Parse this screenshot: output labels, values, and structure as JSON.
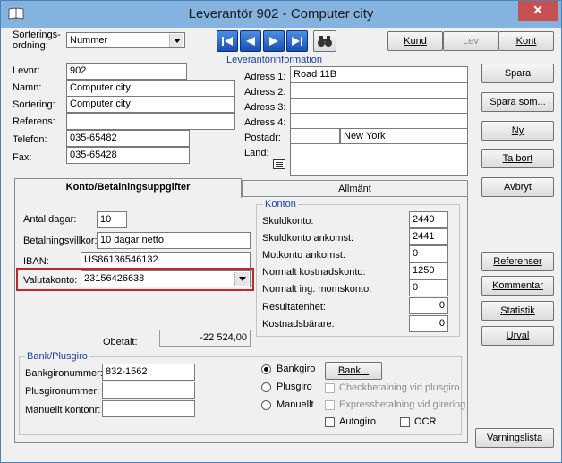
{
  "window": {
    "title": "Leverantör 902 - Computer city",
    "close_glyph": "✕"
  },
  "sort": {
    "label_line1": "Sorterings-",
    "label_line2": "ordning:",
    "value": "Nummer"
  },
  "toolbar": {
    "kund_label": "Kund",
    "lev_label": "Lev",
    "kont_label": "Kont"
  },
  "supplier": {
    "section_title": "Leverantörinformation",
    "levnr_label": "Levnr:",
    "levnr": "902",
    "namn_label": "Namn:",
    "namn": "Computer city",
    "sortering_label": "Sortering:",
    "sortering": "Computer city",
    "referens_label": "Referens:",
    "referens": "",
    "telefon_label": "Telefon:",
    "telefon": "035-65482",
    "fax_label": "Fax:",
    "fax": "035-65428",
    "adress1_label": "Adress 1:",
    "adress1": "Road 11B",
    "adress2_label": "Adress 2:",
    "adress2": "",
    "adress3_label": "Adress 3:",
    "adress3": "",
    "adress4_label": "Adress 4:",
    "adress4": "",
    "postadr_label": "Postadr:",
    "postnr": "",
    "ort": "New York",
    "land_label": "Land:",
    "land": "",
    "land2": ""
  },
  "side_buttons": {
    "spara": "Spara",
    "spara_som": "Spara som...",
    "ny": "Ny",
    "ta_bort": "Ta bort",
    "avbryt": "Avbryt",
    "referenser": "Referenser",
    "kommentar": "Kommentar",
    "statistik": "Statistik",
    "urval": "Urval",
    "varningslista": "Varningslista"
  },
  "tabs": {
    "konto": "Konto/Betalningsuppgifter",
    "allmant": "Allmänt"
  },
  "payment": {
    "antal_dagar_label": "Antal dagar:",
    "antal_dagar": "10",
    "betalningsvillkor_label": "Betalningsvillkor:",
    "betalningsvillkor": "10 dagar netto",
    "iban_label": "IBAN:",
    "iban": "US86136546132",
    "valutakonto_label": "Valutakonto:",
    "valutakonto": "23156426638",
    "obetalt_label": "Obetalt:",
    "obetalt": "-22 524,00"
  },
  "konton": {
    "title": "Konton",
    "skuldkonto_label": "Skuldkonto:",
    "skuldkonto": "2440",
    "skuldkonto_ankomst_label": "Skuldkonto ankomst:",
    "skuldkonto_ankomst": "2441",
    "motkonto_label": "Motkonto ankomst:",
    "motkonto": "0",
    "kostnadskonto_label": "Normalt kostnadskonto:",
    "kostnadskonto": "1250",
    "momskonto_label": "Normalt ing. momskonto:",
    "momskonto": "0",
    "resultatenhet_label": "Resultatenhet:",
    "resultatenhet": "0",
    "kostnadsbarare_label": "Kostnadsbärare:",
    "kostnadsbarare": "0"
  },
  "bank": {
    "title": "Bank/Plusgiro",
    "bankgiro_label": "Bankgironummer:",
    "bankgiro": "832-1562",
    "plusgiro_label": "Plusgironummer:",
    "plusgiro": "",
    "manuellt_label": "Manuellt kontonr:",
    "manuellt": "",
    "radio_bankgiro": "Bankgiro",
    "radio_plusgiro": "Plusgiro",
    "radio_manuellt": "Manuellt",
    "bank_button": "Bank...",
    "chk_checkbetalning": "Checkbetalning vid plusgiro",
    "chk_express": "Expressbetalning vid girering",
    "chk_autogiro": "Autogiro",
    "chk_ocr": "OCR"
  },
  "colors": {
    "titlebar": "#84b3df",
    "highlight_border": "#c0272d",
    "group_title": "#1a3ea8"
  }
}
